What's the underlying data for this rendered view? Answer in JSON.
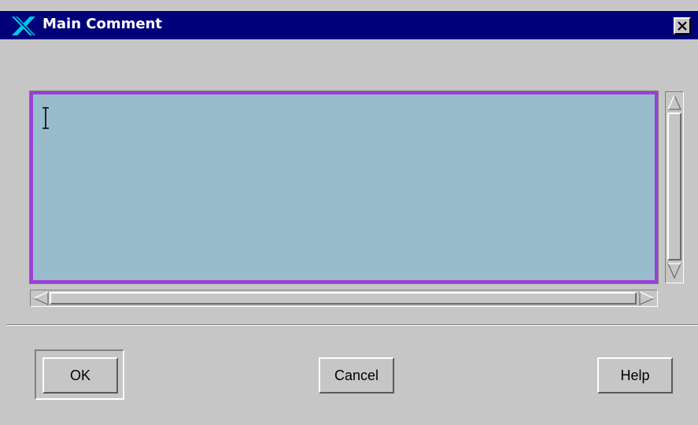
{
  "window": {
    "title": "Main Comment",
    "close_label": "Close"
  },
  "comment": {
    "value": "",
    "placeholder": ""
  },
  "buttons": {
    "ok": "OK",
    "cancel": "Cancel",
    "help": "Help"
  },
  "colors": {
    "titlebar": "#00007b",
    "text_area_bg": "#99bccc",
    "focus_border": "#9a3fd8",
    "dialog_bg": "#c6c6c6"
  },
  "icons": {
    "app": "x-logo-icon",
    "close": "close-icon",
    "scroll_up": "arrow-up-icon",
    "scroll_down": "arrow-down-icon",
    "scroll_left": "arrow-left-icon",
    "scroll_right": "arrow-right-icon"
  }
}
